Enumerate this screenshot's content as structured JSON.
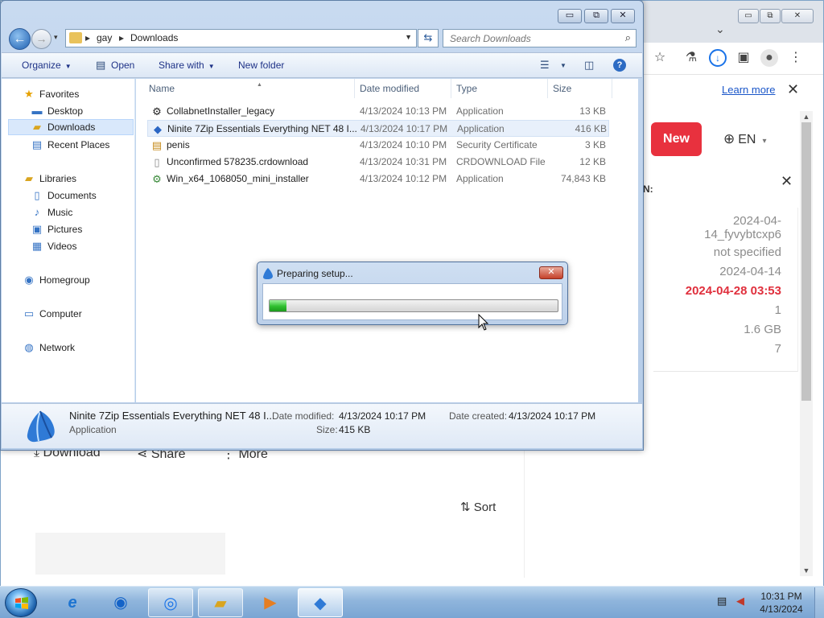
{
  "chrome": {
    "window_controls": {
      "minimize": "▭",
      "restore": "⧉",
      "close": "✕"
    },
    "tab_caret": "⌄",
    "learn_more": "Learn more",
    "infobar_close": "✕",
    "new_button": "New",
    "language": "EN",
    "panel_close": "✕",
    "panel_label": "N:",
    "panel_values": [
      "2024-04-",
      "14_fyvybtcxp6",
      "not specified",
      "2024-04-14",
      "2024-04-28 03:53",
      "1",
      "1.6 GB",
      "7"
    ],
    "actions": {
      "download": "Download",
      "share": "Share",
      "more": "More"
    },
    "sort": "Sort",
    "accent_red": "#e8313e"
  },
  "explorer": {
    "window_controls": {
      "minimize": "▭",
      "restore": "⧉",
      "close": "✕"
    },
    "breadcrumb": [
      "gay",
      "Downloads"
    ],
    "search_placeholder": "Search Downloads",
    "toolbar": {
      "organize": "Organize",
      "open": "Open",
      "share_with": "Share with",
      "new_folder": "New folder"
    },
    "nav": {
      "favorites": "Favorites",
      "desktop": "Desktop",
      "downloads": "Downloads",
      "recent_places": "Recent Places",
      "libraries": "Libraries",
      "documents": "Documents",
      "music": "Music",
      "pictures": "Pictures",
      "videos": "Videos",
      "homegroup": "Homegroup",
      "computer": "Computer",
      "network": "Network"
    },
    "columns": {
      "name": "Name",
      "date_modified": "Date modified",
      "type": "Type",
      "size": "Size"
    },
    "files": [
      {
        "icon": "installer-icon",
        "name": "CollabnetInstaller_legacy",
        "date": "4/13/2024 10:13 PM",
        "type": "Application",
        "size": "13 KB"
      },
      {
        "icon": "ninite-icon",
        "name": "Ninite 7Zip Essentials Everything NET 48 I...",
        "date": "4/13/2024 10:17 PM",
        "type": "Application",
        "size": "416 KB"
      },
      {
        "icon": "certificate-icon",
        "name": "penis",
        "date": "4/13/2024 10:10 PM",
        "type": "Security Certificate",
        "size": "3 KB"
      },
      {
        "icon": "file-icon",
        "name": "Unconfirmed 578235.crdownload",
        "date": "4/13/2024 10:31 PM",
        "type": "CRDOWNLOAD File",
        "size": "12 KB"
      },
      {
        "icon": "installer-icon",
        "name": "Win_x64_1068050_mini_installer",
        "date": "4/13/2024 10:12 PM",
        "type": "Application",
        "size": "74,843 KB"
      }
    ],
    "details": {
      "name": "Ninite 7Zip Essentials Everything NET 48 I...",
      "type": "Application",
      "date_modified_label": "Date modified:",
      "date_modified": "4/13/2024 10:17 PM",
      "date_created_label": "Date created:",
      "date_created": "4/13/2024 10:17 PM",
      "size_label": "Size:",
      "size": "415 KB"
    }
  },
  "dialog": {
    "title": "Preparing setup...",
    "close": "✕",
    "progress_fraction": 0.06
  },
  "taskbar": {
    "apps": [
      "internet-explorer-icon",
      "firefox-icon",
      "chrome-icon",
      "file-explorer-icon",
      "media-player-icon",
      "ninite-icon"
    ],
    "time": "10:31 PM",
    "date": "4/13/2024"
  }
}
